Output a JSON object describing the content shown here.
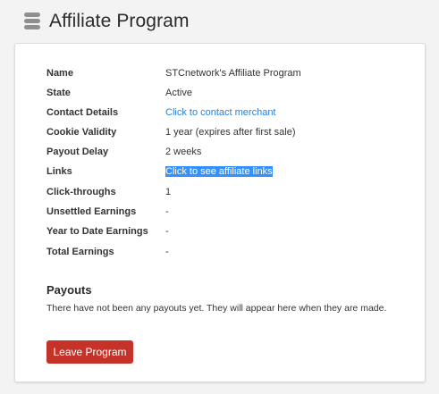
{
  "header": {
    "title": "Affiliate Program",
    "icon": "database-icon"
  },
  "details": [
    {
      "key": "name",
      "label": "Name",
      "value": "STCnetwork's Affiliate Program",
      "link": false
    },
    {
      "key": "state",
      "label": "State",
      "value": "Active",
      "link": false
    },
    {
      "key": "contact",
      "label": "Contact Details",
      "value": "Click to contact merchant",
      "link": true
    },
    {
      "key": "cookie",
      "label": "Cookie Validity",
      "value": "1 year (expires after first sale)",
      "link": false
    },
    {
      "key": "payout-delay",
      "label": "Payout Delay",
      "value": "2 weeks",
      "link": false
    },
    {
      "key": "links",
      "label": "Links",
      "value": "Click to see affiliate links",
      "link": true,
      "selected": true
    },
    {
      "key": "click-throughs",
      "label": "Click-throughs",
      "value": "1",
      "link": false
    },
    {
      "key": "unsettled",
      "label": "Unsettled Earnings",
      "value": "-",
      "link": false
    },
    {
      "key": "ytd",
      "label": "Year to Date Earnings",
      "value": "-",
      "link": false
    },
    {
      "key": "total",
      "label": "Total Earnings",
      "value": "-",
      "link": false
    }
  ],
  "payouts": {
    "title": "Payouts",
    "message": "There have not been any payouts yet. They will appear here when they are made."
  },
  "actions": {
    "leave_label": "Leave Program"
  },
  "colors": {
    "link": "#2a7fd0",
    "selection": "#3390ff",
    "danger_button": "#c53328",
    "page_background": "#f3f3f3"
  }
}
